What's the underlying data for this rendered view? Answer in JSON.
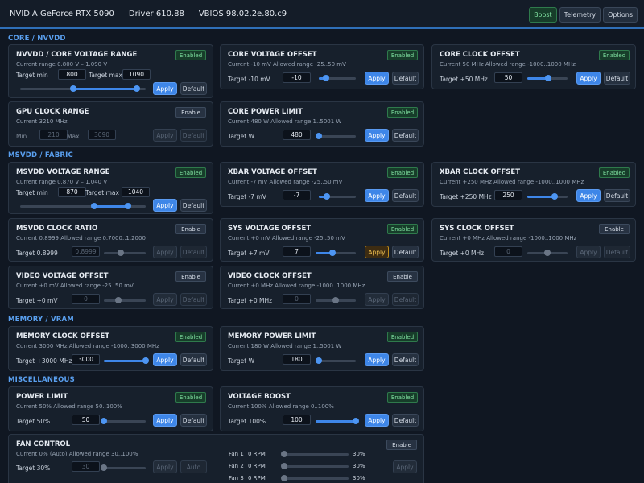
{
  "header": {
    "gpu": "NVIDIA GeForce RTX 5090",
    "driver": "Driver 610.88",
    "vbios": "VBIOS 98.02.2e.80.c9",
    "buttons": {
      "boost": "Boost",
      "telemetry": "Telemetry",
      "options": "Options"
    }
  },
  "common": {
    "apply": "Apply",
    "default": "Default",
    "enabled": "Enabled",
    "enable": "Enable",
    "min": "Min",
    "max": "Max",
    "auto": "Auto"
  },
  "sections": {
    "core": "CORE / NVVDD",
    "msvdd": "MSVDD / FABRIC",
    "memory": "MEMORY / VRAM",
    "misc": "MISCELLANEOUS"
  },
  "cards": {
    "nvvdd_range": {
      "title": "NVVDD / CORE VOLTAGE RANGE",
      "info": "Current range 0.800 V – 1.090 V",
      "label_min": "Target min",
      "value_min": "800",
      "label_max": "Target max",
      "value_max": "1090",
      "range_low": 0.42,
      "range_high": 0.93
    },
    "core_voltage_offset": {
      "title": "CORE VOLTAGE OFFSET",
      "info": "Current -10 mV   Allowed range -25..50 mV",
      "label": "Target -10 mV",
      "value": "-10",
      "level": 0.2
    },
    "core_clock_offset": {
      "title": "CORE CLOCK OFFSET",
      "info": "Current 50 MHz   Allowed range -1000..1000 MHz",
      "label": "Target +50 MHz",
      "value": "50",
      "level": 0.52
    },
    "gpu_clock_range": {
      "title": "GPU CLOCK RANGE",
      "info": "Current 3210 MHz",
      "value_min": "210",
      "value_max": "3090"
    },
    "core_power_limit": {
      "title": "CORE POWER LIMIT",
      "info": "Current 480 W   Allowed range 1..5001 W",
      "label": "Target W",
      "value": "480",
      "level": 0.0
    },
    "msvdd_range": {
      "title": "MSVDD VOLTAGE RANGE",
      "info": "Current range 0.870 V – 1.040 V",
      "label_min": "Target min",
      "value_min": "870",
      "label_max": "Target max",
      "value_max": "1040",
      "range_low": 0.59,
      "range_high": 0.86
    },
    "xbar_voltage_offset": {
      "title": "XBAR VOLTAGE OFFSET",
      "info": "Current -7 mV   Allowed range -25..50 mV",
      "label": "Target -7 mV",
      "value": "-7",
      "level": 0.22
    },
    "xbar_clock_offset": {
      "title": "XBAR CLOCK OFFSET",
      "info": "Current +250 MHz   Allowed range -1000..1000 MHz",
      "label": "Target +250 MHz",
      "value": "250",
      "level": 0.68
    },
    "msvdd_clock_ratio": {
      "title": "MSVDD CLOCK RATIO",
      "info": "Current 0.8999   Allowed range 0.7000..1.2000",
      "label": "Target 0.8999",
      "value": "0.8999",
      "level": 0.4
    },
    "sys_voltage_offset": {
      "title": "SYS VOLTAGE OFFSET",
      "info": "Current +0 mV   Allowed range -25..50 mV",
      "label": "Target +7 mV",
      "value": "7",
      "level": 0.42
    },
    "sys_clock_offset": {
      "title": "SYS CLOCK OFFSET",
      "info": "Current +0 MHz   Allowed range -1000..1000 MHz",
      "label": "Target +0 MHz",
      "value": "0",
      "level": 0.5
    },
    "video_voltage_offset": {
      "title": "VIDEO VOLTAGE OFFSET",
      "info": "Current +0 mV   Allowed range -25..50 mV",
      "label": "Target +0 mV",
      "value": "0",
      "level": 0.34
    },
    "video_clock_offset": {
      "title": "VIDEO CLOCK OFFSET",
      "info": "Current +0 MHz   Allowed range -1000..1000 MHz",
      "label": "Target +0 MHz",
      "value": "0",
      "level": 0.5
    },
    "memory_clock_offset": {
      "title": "MEMORY CLOCK OFFSET",
      "info": "Current 3000 MHz   Allowed range -1000..3000 MHz",
      "label": "Target +3000 MHz",
      "value": "3000",
      "level": 1.0
    },
    "memory_power_limit": {
      "title": "MEMORY POWER LIMIT",
      "info": "Current 180 W   Allowed range 1..5001 W",
      "label": "Target W",
      "value": "180",
      "level": 0.0
    },
    "power_limit": {
      "title": "POWER LIMIT",
      "info": "Current 50%   Allowed range 50..100%",
      "label": "Target 50%",
      "value": "50",
      "level": 0.0
    },
    "voltage_boost": {
      "title": "VOLTAGE BOOST",
      "info": "Current 100%   Allowed range 0..100%",
      "label": "Target 100%",
      "value": "100",
      "level": 1.0
    },
    "fan_control": {
      "title": "FAN CONTROL",
      "info": "Current 0% (Auto)   Allowed range 30..100%",
      "label": "Target 30%",
      "value": "30",
      "level": 0.0,
      "fans": [
        {
          "name": "Fan 1",
          "rpm": "0 RPM",
          "pct": "30%",
          "level": 0.0
        },
        {
          "name": "Fan 2",
          "rpm": "0 RPM",
          "pct": "30%",
          "level": 0.0
        },
        {
          "name": "Fan 3",
          "rpm": "0 RPM",
          "pct": "30%",
          "level": 0.0
        }
      ]
    }
  }
}
